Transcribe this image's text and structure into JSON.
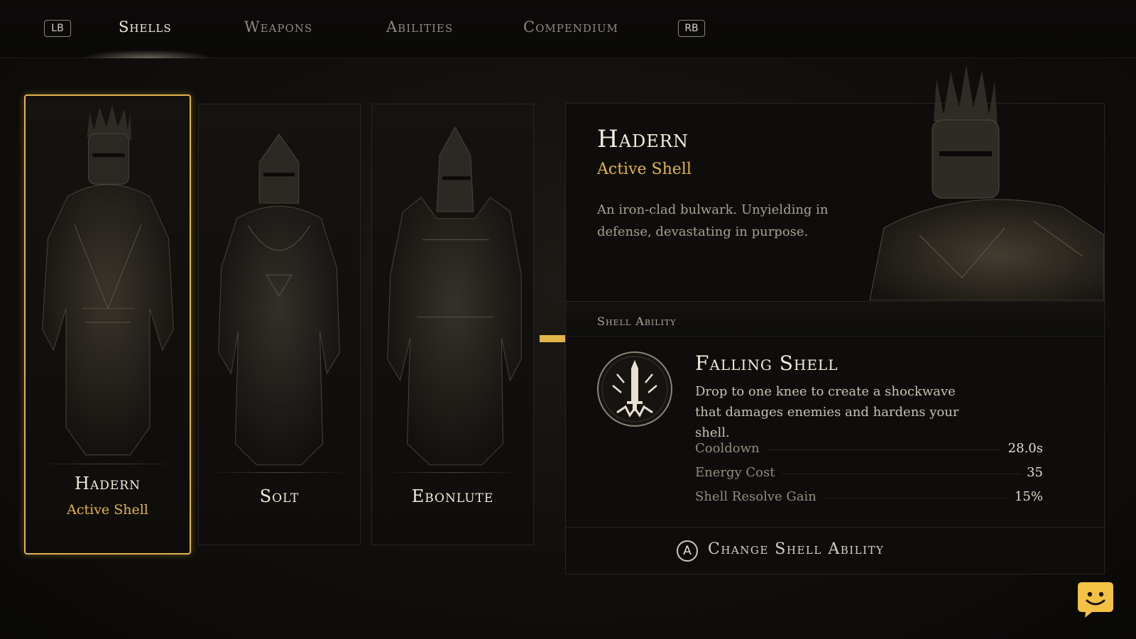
{
  "nav": {
    "left_bumper": "LB",
    "right_bumper": "RB",
    "tabs": [
      {
        "label": "Shells"
      },
      {
        "label": "Weapons"
      },
      {
        "label": "Abilities"
      },
      {
        "label": "Compendium"
      }
    ],
    "active_tab": "Shells"
  },
  "shells": [
    {
      "name": "Hadern",
      "status": "Active Shell"
    },
    {
      "name": "Solt",
      "status": ""
    },
    {
      "name": "Ebonlute",
      "status": ""
    }
  ],
  "detail": {
    "name": "Hadern",
    "status": "Active Shell",
    "description": "An iron-clad bulwark. Unyielding in defense, devastating in purpose.",
    "section_label": "Shell Ability",
    "ability": {
      "name": "Falling Shell",
      "description": "Drop to one knee to create a shockwave that damages enemies and hardens your shell.",
      "icon": "sword-shockwave-icon",
      "stats": [
        {
          "label": "Cooldown",
          "value": "28.0s"
        },
        {
          "label": "Energy Cost",
          "value": "35"
        },
        {
          "label": "Shell Resolve Gain",
          "value": "15%"
        }
      ]
    },
    "change_button": {
      "glyph": "A",
      "label": "Change Shell Ability"
    }
  },
  "colors": {
    "accent": "#e2b44a",
    "text": "#f1ead9",
    "muted": "#948c7e",
    "bubble": "#f3c144"
  },
  "icons": [
    "pointer-arrow-icon",
    "chat-bubble-icon"
  ]
}
